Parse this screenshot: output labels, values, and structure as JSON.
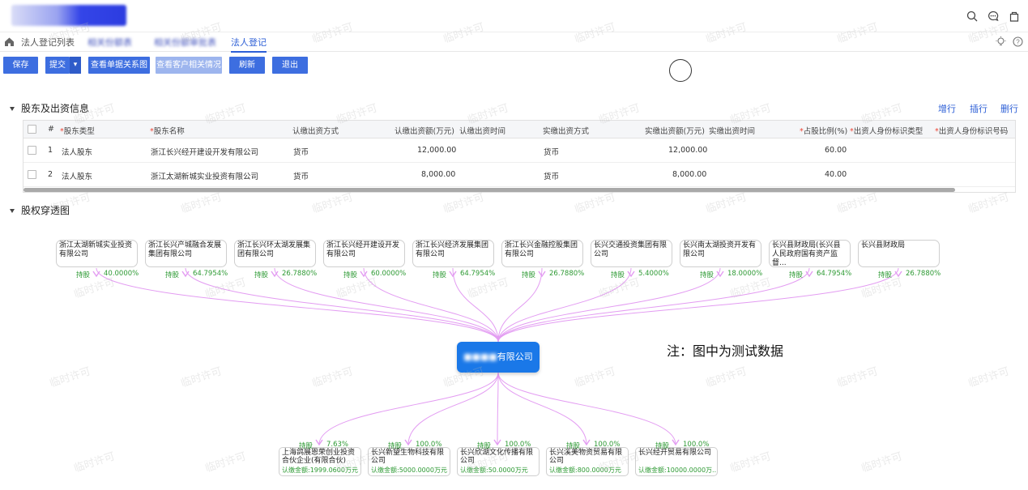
{
  "tabs": [
    "法人登记列表",
    "相关份额表",
    "相关份额审批表",
    "法人登记"
  ],
  "toolbar": {
    "save": "保存",
    "submit": "提交",
    "view_relation": "查看单据关系图",
    "view_customer": "查看客户相关情况",
    "refresh": "刷新",
    "exit": "退出"
  },
  "shareholder_section": {
    "title": "股东及出资信息",
    "actions": [
      "增行",
      "插行",
      "删行"
    ],
    "columns": [
      "#",
      "股东类型",
      "股东名称",
      "认缴出资方式",
      "认缴出资额(万元)",
      "认缴出资时间",
      "实缴出资方式",
      "实缴出资额(万元)",
      "实缴出资时间",
      "占股比例(%)",
      "出资人身份标识类型",
      "出资人身份标识号码"
    ],
    "rows": [
      {
        "no": "1",
        "type": "法人股东",
        "name": "浙江长兴经开建设开发有限公司",
        "sub_method": "货币",
        "sub_amount": "12,000.00",
        "sub_time": "",
        "paid_method": "货币",
        "paid_amount": "12,000.00",
        "paid_time": "",
        "ratio": "60.00"
      },
      {
        "no": "2",
        "type": "法人股东",
        "name": "浙江太湖新城实业投资有限公司",
        "sub_method": "货币",
        "sub_amount": "8,000.00",
        "sub_time": "",
        "paid_method": "货币",
        "paid_amount": "8,000.00",
        "paid_time": "",
        "ratio": "40.00"
      }
    ]
  },
  "equity_section": {
    "title": "股权穿透图",
    "note": "注：图中为测试数据",
    "center_company_suffix": "有限公司",
    "shareholders": [
      {
        "name": "浙江太湖新城实业投资有限公司",
        "label": "持股",
        "pct": "40.0000%"
      },
      {
        "name": "浙江长兴产城融合发展集团有限公司",
        "label": "持股",
        "pct": "64.7954%"
      },
      {
        "name": "浙江长兴环太湖发展集团有限公司",
        "label": "持股",
        "pct": "26.7880%"
      },
      {
        "name": "浙江长兴经开建设开发有限公司",
        "label": "持股",
        "pct": "60.0000%"
      },
      {
        "name": "浙江长兴经济发展集团有限公司",
        "label": "持股",
        "pct": "64.7954%"
      },
      {
        "name": "浙江长兴金融控股集团有限公司",
        "label": "持股",
        "pct": "26.7880%"
      },
      {
        "name": "长兴交通投资集团有限公司",
        "label": "持股",
        "pct": "5.4000%"
      },
      {
        "name": "长兴南太湖投资开发有限公司",
        "label": "持股",
        "pct": "18.0000%"
      },
      {
        "name": "长兴县财政局(长兴县人民政府国有资产监督...",
        "label": "持股",
        "pct": "64.7954%"
      },
      {
        "name": "长兴县财政局",
        "label": "持股",
        "pct": "26.7880%"
      }
    ],
    "subsidiaries": [
      {
        "name": "上海鸽展恩荣创业投资合伙企业(有限合伙)",
        "label": "持股",
        "pct": "7.63%",
        "amount": "认缴金额:1999.0600万元"
      },
      {
        "name": "长兴新望生物科技有限公司",
        "label": "持股",
        "pct": "100.0%",
        "amount": "认缴金额:5000.0000万元"
      },
      {
        "name": "长兴欣湖文化传播有限公司",
        "label": "持股",
        "pct": "100.0%",
        "amount": "认缴金额:50.0000万元"
      },
      {
        "name": "长兴溪美物资贸易有限公司",
        "label": "持股",
        "pct": "100.0%",
        "amount": "认缴金额:800.0000万元"
      },
      {
        "name": "长兴经开贸易有限公司",
        "label": "持股",
        "pct": "100.0%",
        "amount": "认缴金额:10000.0000万..."
      }
    ]
  },
  "watermark": "临时许可",
  "colors": {
    "primary": "#3d6ee0",
    "link": "#2d5fd6",
    "green": "#2e9a34",
    "edge": "#e39cf2",
    "center": "#1a78e8"
  }
}
